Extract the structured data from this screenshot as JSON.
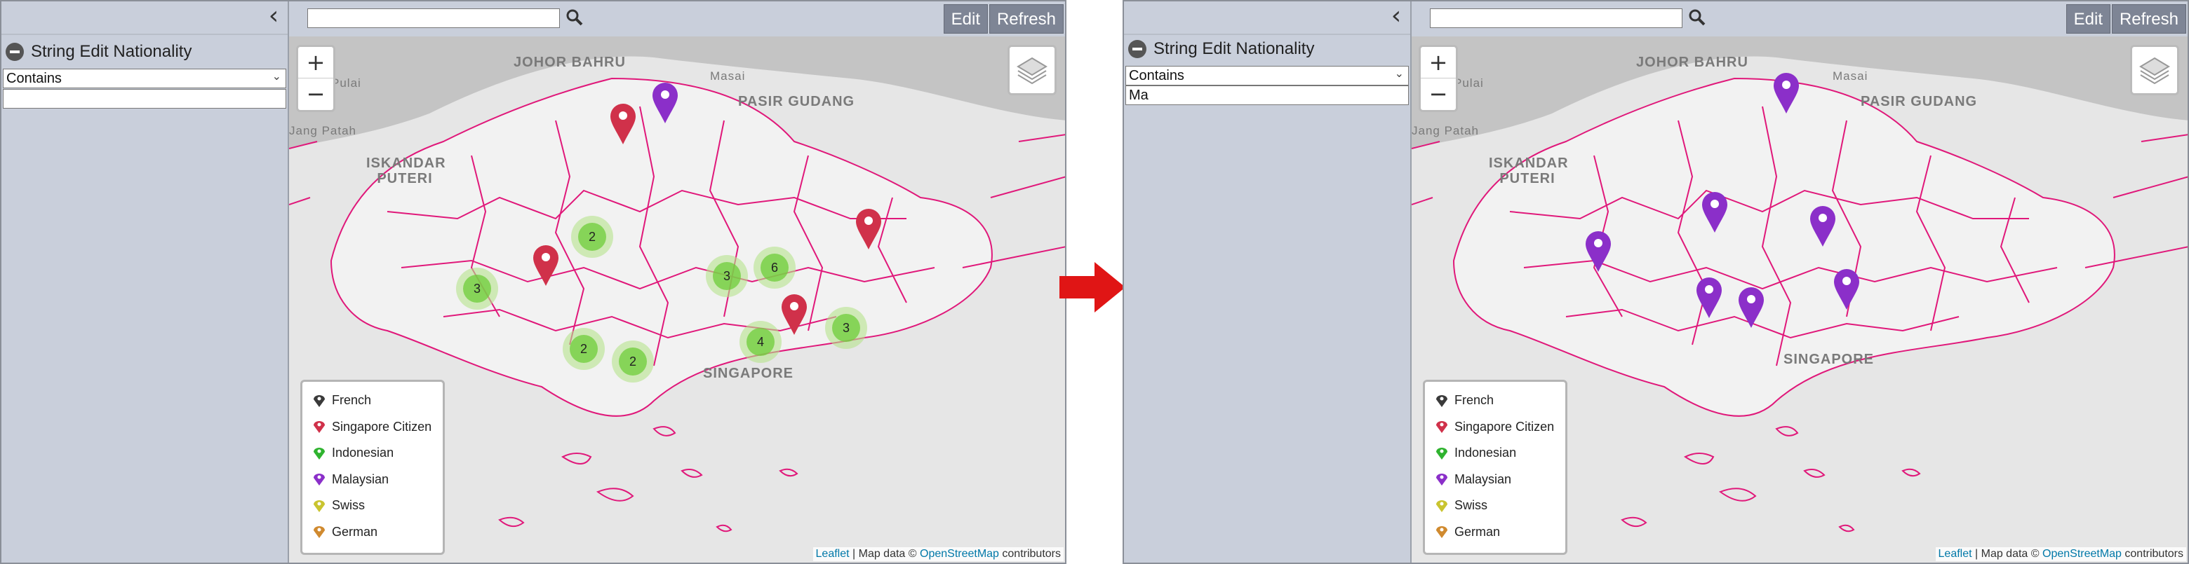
{
  "colors": {
    "border": "#e0187a",
    "singapore_citizen": "#d0314a",
    "malaysian": "#8b2fc9",
    "cluster_inner": "#6ecc39",
    "arrow": "#e01515"
  },
  "before": {
    "filter_title": "String Edit Nationality",
    "select_value": "Contains",
    "input_value": "",
    "edit_label": "Edit",
    "refresh_label": "Refresh",
    "clusters": [
      {
        "count": "2"
      },
      {
        "count": "3"
      },
      {
        "count": "6"
      },
      {
        "count": "3"
      },
      {
        "count": "2"
      },
      {
        "count": "2"
      },
      {
        "count": "4"
      },
      {
        "count": "3"
      }
    ],
    "markers": [
      {
        "nationality": "Singapore Citizen",
        "color": "#d0314a"
      },
      {
        "nationality": "Malaysian",
        "color": "#8b2fc9"
      },
      {
        "nationality": "Singapore Citizen",
        "color": "#d0314a"
      },
      {
        "nationality": "Singapore Citizen",
        "color": "#d0314a"
      },
      {
        "nationality": "Singapore Citizen",
        "color": "#d0314a"
      }
    ]
  },
  "after": {
    "filter_title": "String Edit Nationality",
    "select_value": "Contains",
    "input_value": "Ma",
    "edit_label": "Edit",
    "refresh_label": "Refresh",
    "markers": [
      {
        "nationality": "Malaysian"
      },
      {
        "nationality": "Malaysian"
      },
      {
        "nationality": "Malaysian"
      },
      {
        "nationality": "Malaysian"
      },
      {
        "nationality": "Malaysian"
      },
      {
        "nationality": "Malaysian"
      },
      {
        "nationality": "Malaysian"
      }
    ]
  },
  "map_labels": {
    "johor_bahru": "JOHOR BAHRU",
    "masai": "Masai",
    "pasir_gudang": "PASIR GUDANG",
    "pulai": "Pulai",
    "jang_patah": "Jang Patah",
    "iskandar_puteri": "ISKANDAR PUTERI",
    "singapore": "SINGAPORE"
  },
  "legend": [
    {
      "label": "French",
      "color": "#3a3a3a"
    },
    {
      "label": "Singapore Citizen",
      "color": "#d0314a"
    },
    {
      "label": "Indonesian",
      "color": "#2fb32f"
    },
    {
      "label": "Malaysian",
      "color": "#8b2fc9"
    },
    {
      "label": "Swiss",
      "color": "#c9c42f"
    },
    {
      "label": "German",
      "color": "#d08a2f"
    }
  ],
  "attribution": {
    "leaflet": "Leaflet",
    "sep": " | Map data © ",
    "osm": "OpenStreetMap",
    "suffix": " contributors"
  }
}
